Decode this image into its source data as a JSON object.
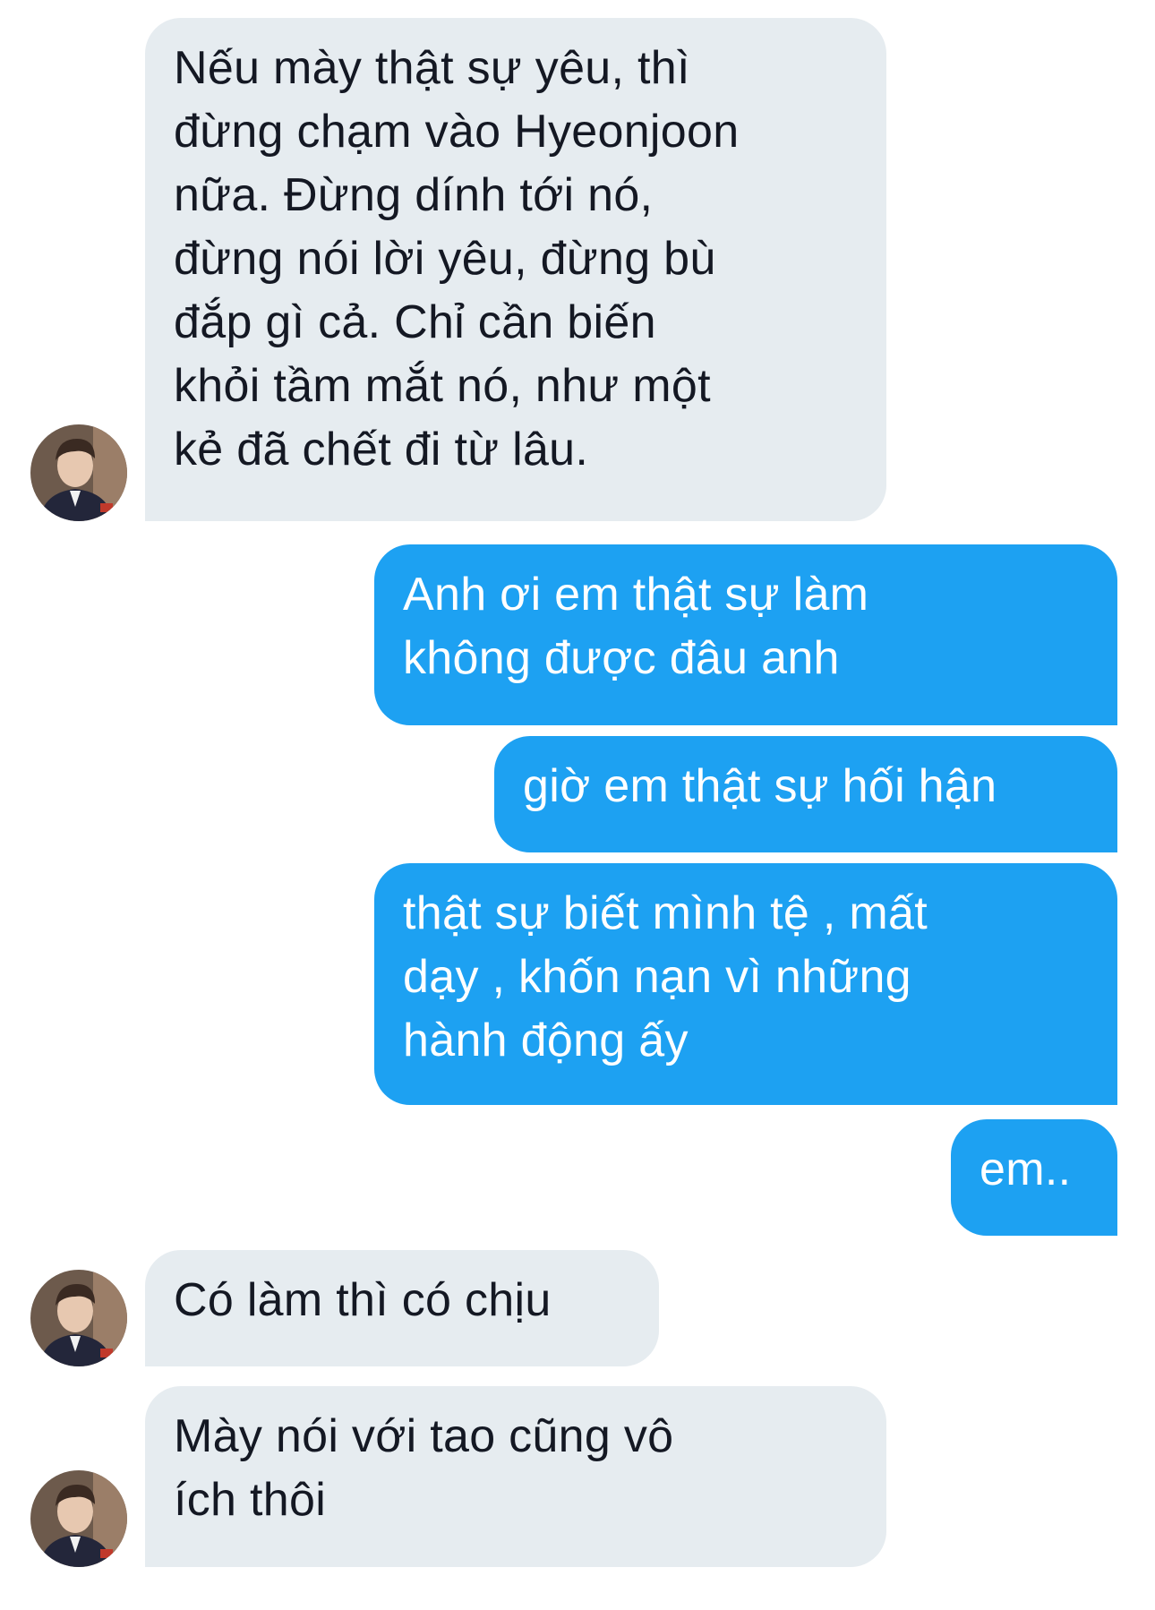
{
  "conversation": {
    "messages": [
      {
        "side": "incoming",
        "text": "Nếu mày thật sự yêu, thì\nđừng chạm vào Hyeonjoon\nnữa. Đừng dính tới nó,\nđừng nói lời yêu, đừng bù\nđắp gì cả. Chỉ cần biến\nkhỏi tầm mắt nó, như một\nkẻ đã chết đi từ lâu."
      },
      {
        "side": "outgoing",
        "text": "Anh ơi em thật sự làm\nkhông được đâu anh"
      },
      {
        "side": "outgoing",
        "text": "giờ em thật sự hối hận"
      },
      {
        "side": "outgoing",
        "text": "thật sự biết mình tệ , mất\ndạy , khốn nạn vì những\nhành động ấy"
      },
      {
        "side": "outgoing",
        "text": "em.."
      },
      {
        "side": "incoming",
        "text": "Có làm thì có chịu"
      },
      {
        "side": "incoming",
        "text": "Mày nói với tao cũng vô\ních thôi"
      }
    ]
  },
  "colors": {
    "incoming_bubble": "#e6ecf0",
    "incoming_text": "#141823",
    "outgoing_bubble": "#1da1f2",
    "outgoing_text": "#ffffff",
    "background": "#ffffff"
  },
  "icons": {
    "avatar": "user-photo-avatar"
  }
}
